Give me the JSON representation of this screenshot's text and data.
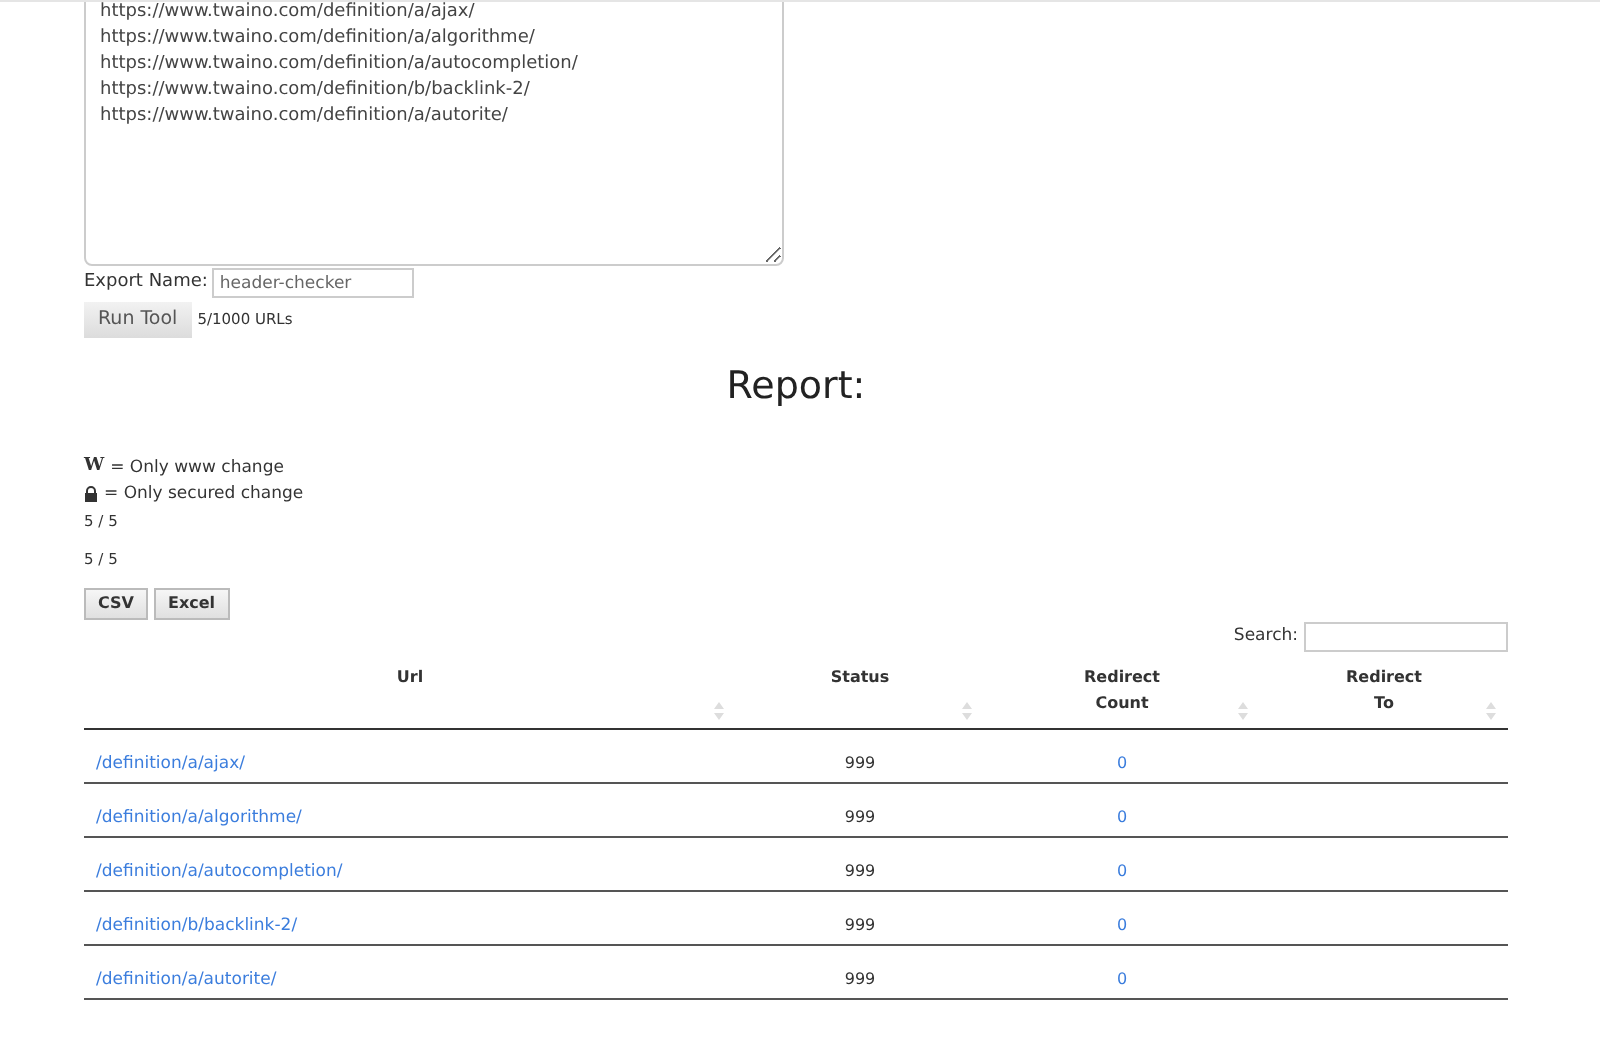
{
  "urls_input": {
    "lines": [
      "https://www.twaino.com/definition/a/ajax/",
      "https://www.twaino.com/definition/a/algorithme/",
      "https://www.twaino.com/definition/a/autocompletion/",
      "https://www.twaino.com/definition/b/backlink-2/",
      "https://www.twaino.com/definition/a/autorite/"
    ]
  },
  "export_name": {
    "label": "Export Name:",
    "value": "header-checker"
  },
  "run_button": "Run Tool",
  "url_count": "5/1000 URLs",
  "report_title": "Report:",
  "legend": [
    {
      "kind": "letter",
      "symbol": "W",
      "text": "= Only www change"
    },
    {
      "kind": "lock",
      "text": "= Only secured change"
    }
  ],
  "counts": [
    "5 / 5",
    "5 / 5"
  ],
  "export_buttons": [
    "CSV",
    "Excel"
  ],
  "search": {
    "label": "Search:"
  },
  "table": {
    "columns": [
      "Url",
      "Status",
      "Redirect Count",
      "Redirect To"
    ],
    "rows": [
      {
        "url": "/definition/a/ajax/",
        "status": "999",
        "redirect_count": "0"
      },
      {
        "url": "/definition/a/algorithme/",
        "status": "999",
        "redirect_count": "0"
      },
      {
        "url": "/definition/a/autocompletion/",
        "status": "999",
        "redirect_count": "0"
      },
      {
        "url": "/definition/b/backlink-2/",
        "status": "999",
        "redirect_count": "0"
      },
      {
        "url": "/definition/a/autorite/",
        "status": "999",
        "redirect_count": "0"
      }
    ]
  }
}
